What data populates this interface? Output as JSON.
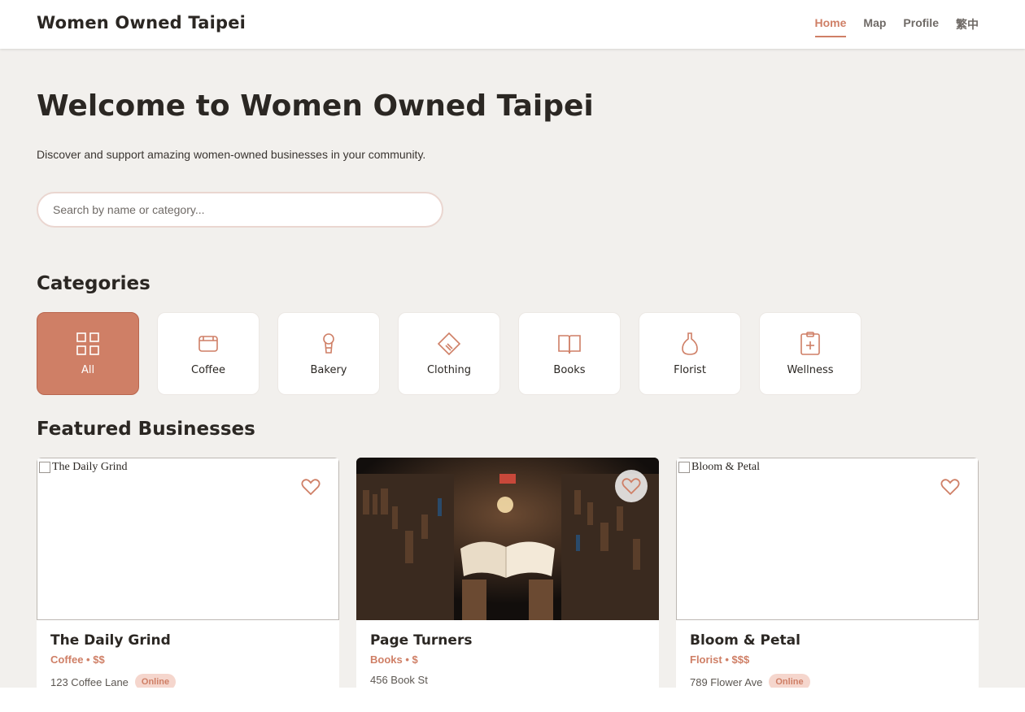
{
  "header": {
    "brand": "Women Owned Taipei",
    "nav": [
      "Home",
      "Map",
      "Profile",
      "繁中"
    ],
    "active_nav": "Home"
  },
  "hero": {
    "title": "Welcome to Women Owned Taipei",
    "subtitle": "Discover and support amazing women-owned businesses in your community.",
    "search_placeholder": "Search by name or category..."
  },
  "categories": {
    "title": "Categories",
    "items": [
      {
        "label": "All",
        "icon": "grid-icon",
        "active": true
      },
      {
        "label": "Coffee",
        "icon": "coffee-icon"
      },
      {
        "label": "Bakery",
        "icon": "bakery-icon"
      },
      {
        "label": "Clothing",
        "icon": "tag-icon"
      },
      {
        "label": "Books",
        "icon": "book-icon"
      },
      {
        "label": "Florist",
        "icon": "flower-icon"
      },
      {
        "label": "Wellness",
        "icon": "medical-icon"
      }
    ]
  },
  "featured": {
    "title": "Featured Businesses",
    "businesses": [
      {
        "name": "The Daily Grind",
        "image_alt": "The Daily Grind",
        "meta": "Coffee • $$",
        "address": "123 Coffee Lane",
        "badge": "Online"
      },
      {
        "name": "Page Turners",
        "image_alt": "Page Turners",
        "meta": "Books • $",
        "address": "456 Book St",
        "badge": ""
      },
      {
        "name": "Bloom & Petal",
        "image_alt": "Bloom & Petal",
        "meta": "Florist • $$$",
        "address": "789 Flower Ave",
        "badge": "Online"
      }
    ]
  },
  "colors": {
    "accent": "#cf7f66",
    "background": "#f2f0ed",
    "badge_bg": "#f5d6cd"
  }
}
